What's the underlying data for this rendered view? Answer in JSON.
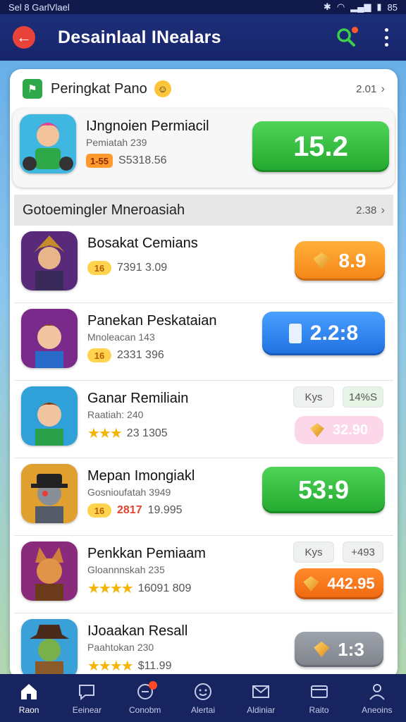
{
  "status_bar": {
    "left_text": "Sel 8 GarlVlael",
    "battery_text": "85"
  },
  "app_bar": {
    "title": "Desainlaal INealars"
  },
  "section1": {
    "title": "Peringkat Pano",
    "meta": "2.01"
  },
  "featured": {
    "title": "IJngnoien Permiacil",
    "subtitle": "Pemiatah 239",
    "badge": "1-55",
    "stat": "S5318.56",
    "score": "15.2"
  },
  "section2": {
    "title": "Gotoemingler Mneroasiah",
    "meta": "2.38"
  },
  "rows": [
    {
      "title": "Bosakat Cemians",
      "subtitle": "",
      "badge": "16",
      "stat": "7391 3.09",
      "score": "8.9",
      "score_style": "orange"
    },
    {
      "title": "Panekan Peskataian",
      "subtitle": "Mnoleacan 143",
      "badge": "16",
      "stat": "2331 396",
      "score": "2.2:8",
      "score_style": "blue"
    },
    {
      "title": "Ganar Remiliain",
      "subtitle": "Raatiah: 240",
      "stars": "★★★",
      "stat": "23 1305",
      "chip1": "Kys",
      "chip2": "14%S",
      "score": "32.90",
      "score_style": "pink"
    },
    {
      "title": "Mepan Imongiakl",
      "subtitle": "Gosnioufatah 3949",
      "badge": "16",
      "stat_red": "2817",
      "stat": "19.995",
      "score": "53:9",
      "score_style": "green"
    },
    {
      "title": "Penkkan Pemiaam",
      "subtitle": "Gloannnskah 235",
      "stars": "★★★★",
      "stat": "16091 809",
      "chip1": "Kys",
      "chip2": "+493",
      "score": "442.95",
      "score_style": "deep-orange"
    },
    {
      "title": "IJoaakan Resall",
      "subtitle": "Paahtokan 230",
      "stars": "★★★★",
      "stat": "$11.99",
      "score": "1:3",
      "score_style": "gray"
    }
  ],
  "bottom_nav": [
    {
      "label": "Raon",
      "icon": "home-icon"
    },
    {
      "label": "Eeinear",
      "icon": "chat-icon"
    },
    {
      "label": "Conobm",
      "icon": "message-icon"
    },
    {
      "label": "Alertai",
      "icon": "smiley-icon"
    },
    {
      "label": "Aldiniar",
      "icon": "mail-icon"
    },
    {
      "label": "Raito",
      "icon": "wallet-icon"
    },
    {
      "label": "Aneoins",
      "icon": "profile-icon"
    }
  ],
  "colors": {
    "app_bar": "#1d2f7a",
    "green": "#22a82d",
    "orange": "#f58416",
    "blue": "#1f6fe0",
    "accent_red": "#e8423a"
  }
}
